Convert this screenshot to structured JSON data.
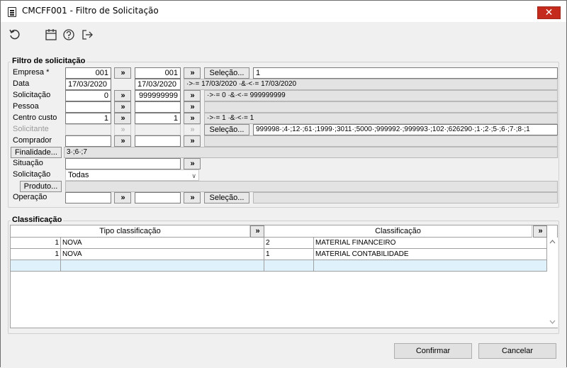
{
  "window": {
    "title": "CMCFF001 - Filtro de Solicitação",
    "close_symbol": "✕"
  },
  "toolbar": {
    "icons": [
      "refresh-icon",
      "calendar-icon",
      "help-icon",
      "exit-icon"
    ]
  },
  "filter": {
    "group_title": "Filtro de solicitação",
    "empresa": {
      "label": "Empresa *",
      "from": "001",
      "to": "001",
      "selection_label": "Seleção...",
      "selection_value": "1"
    },
    "data": {
      "label": "Data",
      "from": "17/03/2020",
      "to": "17/03/2020",
      "summary": "·>·= 17/03/2020 ·&·<·= 17/03/2020"
    },
    "solicitacao": {
      "label": "Solicitação",
      "from": "0",
      "to": "999999999",
      "summary": "·>·= 0 ·&·<·= 999999999"
    },
    "pessoa": {
      "label": "Pessoa",
      "from": "",
      "to": "",
      "summary": ""
    },
    "centro_custo": {
      "label": "Centro custo",
      "from": "1",
      "to": "1",
      "summary": "·>·= 1 ·&·<·= 1"
    },
    "solicitante": {
      "label": "Solicitante",
      "from": "",
      "to": "",
      "selection_label": "Seleção...",
      "selection_value": "999998·;4·;12·;61·;1999·;3011·;5000·;999992·;999993·;102·;626290·;1·;2·;5·;6·;7·;8·;1"
    },
    "comprador": {
      "label": "Comprador",
      "from": "",
      "to": "",
      "summary": ""
    },
    "finalidade": {
      "button_label": "Finalidade...",
      "value": "3·;6·;7"
    },
    "situacao": {
      "label": "Situação",
      "value": ""
    },
    "solicitacao_tipo": {
      "label": "Solicitação",
      "value": "Todas"
    },
    "produto": {
      "button_label": "Produto...",
      "value": ""
    },
    "operacao": {
      "label": "Operação",
      "from": "",
      "to": "",
      "selection_label": "Seleção...",
      "selection_value": ""
    },
    "range_button": "»"
  },
  "classificacao": {
    "group_title": "Classificação",
    "columns": [
      "Tipo classificação",
      "Classificação"
    ],
    "rows": [
      {
        "tipo_code": "1",
        "tipo_name": "NOVA",
        "class_code": "2",
        "class_name": "MATERIAL FINANCEIRO"
      },
      {
        "tipo_code": "1",
        "tipo_name": "NOVA",
        "class_code": "1",
        "class_name": "MATERIAL CONTABILIDADE"
      }
    ]
  },
  "footer": {
    "confirm_label": "Confirmar",
    "cancel_label": "Cancelar"
  }
}
